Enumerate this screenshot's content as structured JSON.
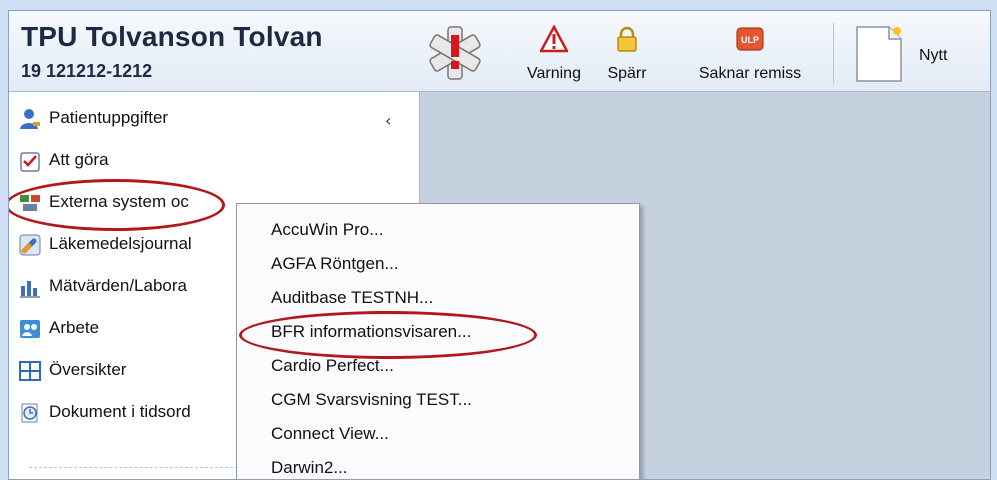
{
  "header": {
    "patient_name": "TPU Tolvanson Tolvan",
    "patient_id": "19 121212-1212",
    "toolbar": [
      {
        "label": "Varning",
        "icon": "warning-icon"
      },
      {
        "label": "Spärr",
        "icon": "lock-icon"
      },
      {
        "label": "Saknar remiss",
        "icon": "ulp-icon"
      }
    ],
    "ulp_badge": "ULP",
    "new_label": "Nytt"
  },
  "sidebar": {
    "collapse_glyph": "‹",
    "items": [
      {
        "label": "Patientuppgifter",
        "icon": "person-icon"
      },
      {
        "label": "Att göra",
        "icon": "checklist-icon"
      },
      {
        "label": "Externa system oc",
        "icon": "external-systems-icon"
      },
      {
        "label": "Läkemedelsjournal",
        "icon": "medication-icon"
      },
      {
        "label": "Mätvärden/Labora",
        "icon": "lab-values-icon"
      },
      {
        "label": "Arbete",
        "icon": "work-icon"
      },
      {
        "label": "Översikter",
        "icon": "overview-grid-icon"
      },
      {
        "label": "Dokument i tidsord",
        "icon": "document-time-icon"
      }
    ]
  },
  "context_menu": {
    "items": [
      "AccuWin Pro...",
      "AGFA Röntgen...",
      "Auditbase TESTNH...",
      "BFR informationsvisaren...",
      "Cardio Perfect...",
      "CGM Svarsvisning TEST...",
      "Connect View...",
      "Darwin2..."
    ]
  },
  "colors": {
    "highlight_ellipse": "#b3161b",
    "header_text": "#1d2a44",
    "content_background": "#c6d1df"
  }
}
